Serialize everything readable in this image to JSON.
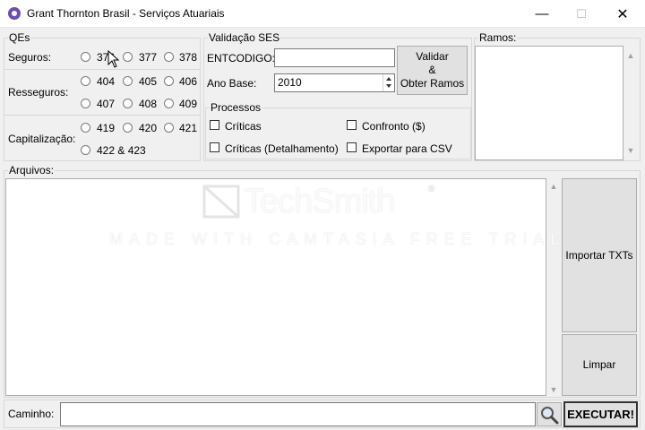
{
  "window": {
    "title": "Grant Thornton Brasil - Serviços Atuariais",
    "min_glyph": "—",
    "max_glyph": "☐",
    "close_glyph": "✕"
  },
  "qes": {
    "legend": "QEs",
    "seguros_label": "Seguros:",
    "resseguros_label": "Resseguros:",
    "capitalizacao_label": "Capitalização:",
    "seguros": [
      "376",
      "377",
      "378"
    ],
    "resseguros_row1": [
      "404",
      "405",
      "406"
    ],
    "resseguros_row2": [
      "407",
      "408",
      "409"
    ],
    "capitalizacao_row1": [
      "419",
      "420",
      "421"
    ],
    "capitalizacao_row2": [
      "422 & 423"
    ]
  },
  "validacao": {
    "legend": "Validação SES",
    "entcodigo_label": "ENTCODIGO:",
    "entcodigo_value": "",
    "ano_base_label": "Ano Base:",
    "ano_base_value": "2010",
    "validar_button": [
      "Validar",
      "&",
      "Obter Ramos"
    ]
  },
  "processos": {
    "legend": "Processos",
    "criticas": "Críticas",
    "criticas_detalhamento": "Críticas (Detalhamento)",
    "confronto": "Confronto ($)",
    "exportar_csv": "Exportar para CSV"
  },
  "ramos": {
    "legend": "Ramos:"
  },
  "arquivos": {
    "legend": "Arquivos:",
    "importar_button": "Importar TXTs",
    "limpar_button": "Limpar"
  },
  "caminho": {
    "label": "Caminho:",
    "value": "",
    "executar_button": "EXECUTAR!"
  },
  "watermark": {
    "brand": "TechSmith",
    "trademark": "®",
    "tagline": "MADE WITH CAMTASIA FREE TRIAL"
  }
}
